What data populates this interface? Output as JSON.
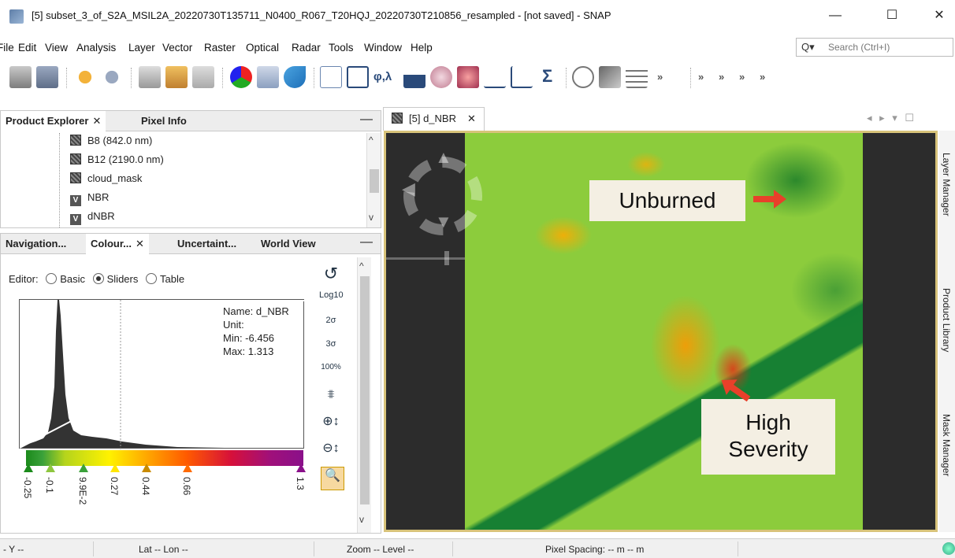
{
  "window": {
    "title": "[5] subset_3_of_S2A_MSIL2A_20220730T135711_N0400_R067_T20HQJ_20220730T210856_resampled - [not saved] - SNAP",
    "minimize": "—",
    "maximize": "☐",
    "close": "✕"
  },
  "menu": [
    "File",
    "Edit",
    "View",
    "Analysis",
    "Layer",
    "Vector",
    "Raster",
    "Optical",
    "Radar",
    "Tools",
    "Window",
    "Help"
  ],
  "search": {
    "icon": "Q▾",
    "placeholder": "Search (Ctrl+I)"
  },
  "toolbar": {
    "icons": [
      "open-product-icon",
      "save-product-icon",
      "undo-icon",
      "redo-icon",
      "band-maths-icon",
      "import-icon",
      "export-icon",
      "rgb-image-icon",
      "window-icon",
      "wave-icon",
      "draw-polygon-icon",
      "draw-line-icon",
      "spectral-icon",
      "histogram-icon",
      "information-icon",
      "statistics-icon",
      "profile-plot-icon",
      "scatter-plot-icon",
      "sigma-icon",
      "pixel-info-icon",
      "mask-icon",
      "grid-icon"
    ],
    "phi_lambda": "φ,λ",
    "sigma": "Σ",
    "overflow": "»"
  },
  "product_explorer": {
    "tabs": [
      {
        "label": "Product Explorer",
        "close": "✕"
      },
      {
        "label": "Pixel Info"
      }
    ],
    "minimize": "—",
    "tree": [
      "B8 (842.0 nm)",
      "B12 (2190.0 nm)",
      "cloud_mask",
      "NBR",
      "dNBR"
    ],
    "scroll_up": "^",
    "scroll_down": "v"
  },
  "colour_panel": {
    "tabs": [
      {
        "label": "Navigation..."
      },
      {
        "label": "Colour...",
        "close": "✕"
      },
      {
        "label": "Uncertaint..."
      },
      {
        "label": "World View"
      }
    ],
    "minimize": "—",
    "editor_label": "Editor:",
    "modes": [
      "Basic",
      "Sliders",
      "Table"
    ],
    "selected_mode": "Sliders",
    "info": {
      "name": "Name: d_NBR",
      "unit": "Unit:",
      "min": "Min: -6.456",
      "max": "Max: 1.313"
    },
    "slider_labels": [
      "-0.25",
      "-0.1",
      "9.9E-2",
      "0.27",
      "0.44",
      "0.66",
      "1.3"
    ],
    "slider_colors": [
      "#1b8a1b",
      "#8ec63f",
      "#3aa13a",
      "#ffe600",
      "#c98a00",
      "#ff6a00",
      "#8a108a"
    ],
    "tools": {
      "reset": "↺",
      "log": "Log10",
      "sigma2": "2σ",
      "sigma3": "3σ",
      "pct100": "100%",
      "distribute": "⩨",
      "zoom_v": "⊕↕",
      "zoom_h": "⊖↕",
      "zoom_fit": "🔍"
    },
    "scroll_up": "^",
    "scroll_down": "v"
  },
  "image_view": {
    "tab_label": "[5] d_NBR",
    "tab_close": "✕",
    "window_controls": "◂ ▸ ▾ ☐",
    "callout_unburned": "Unburned",
    "callout_high_1": "High",
    "callout_high_2": "Severity"
  },
  "right_sidebar": [
    "Layer Manager",
    "Product Library",
    "Mask Manager"
  ],
  "status": {
    "y": "- Y   --",
    "lat": "Lat    -- Lon    --",
    "zoom": "Zoom -- Level --",
    "spacing": "Pixel Spacing: -- m -- m"
  }
}
